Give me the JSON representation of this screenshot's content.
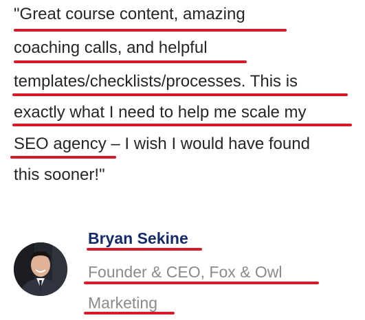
{
  "testimonial": {
    "quote_lines": [
      "\"Great course content, amazing",
      "coaching calls, and helpful",
      "templates/checklists/processes. This is",
      "exactly what I need to help me scale my",
      "SEO agency – I wish I would have found",
      "this sooner!\""
    ],
    "author_name": "Bryan Sekine",
    "author_role_lines": [
      "Founder & CEO, Fox & Owl",
      "Marketing"
    ],
    "avatar_icon": "person-photo-avatar"
  },
  "colors": {
    "underline": "#d31c28",
    "name": "#142a6b",
    "quote_text": "#262626",
    "role_text": "#8a8a8a"
  }
}
